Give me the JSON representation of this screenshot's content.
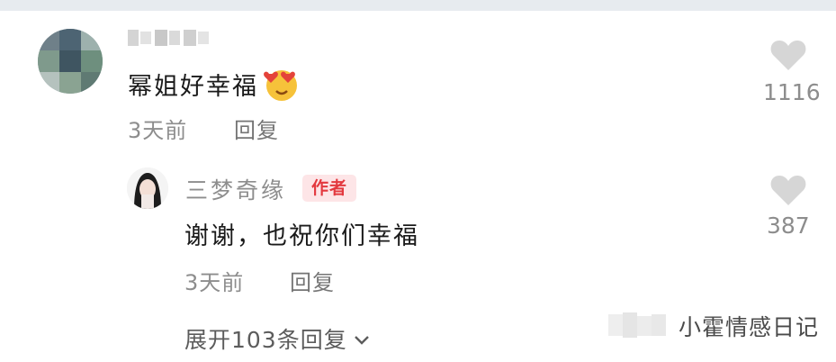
{
  "comments": [
    {
      "text": "幂姐好幸福",
      "emoji": "heart-eyes-emoji",
      "date": "3天前",
      "reply_label": "回复",
      "likes": "1116"
    }
  ],
  "reply": {
    "username": "三梦奇缘",
    "badge": "作者",
    "text": "谢谢，也祝你们幸福",
    "date": "3天前",
    "reply_label": "回复",
    "likes": "387"
  },
  "expand_label": "展开103条回复",
  "watermark": "小霍情感日记",
  "colors": {
    "badge_bg": "#fde5e7",
    "badge_text": "#e3393f",
    "meta_text": "#8d8d8d"
  }
}
